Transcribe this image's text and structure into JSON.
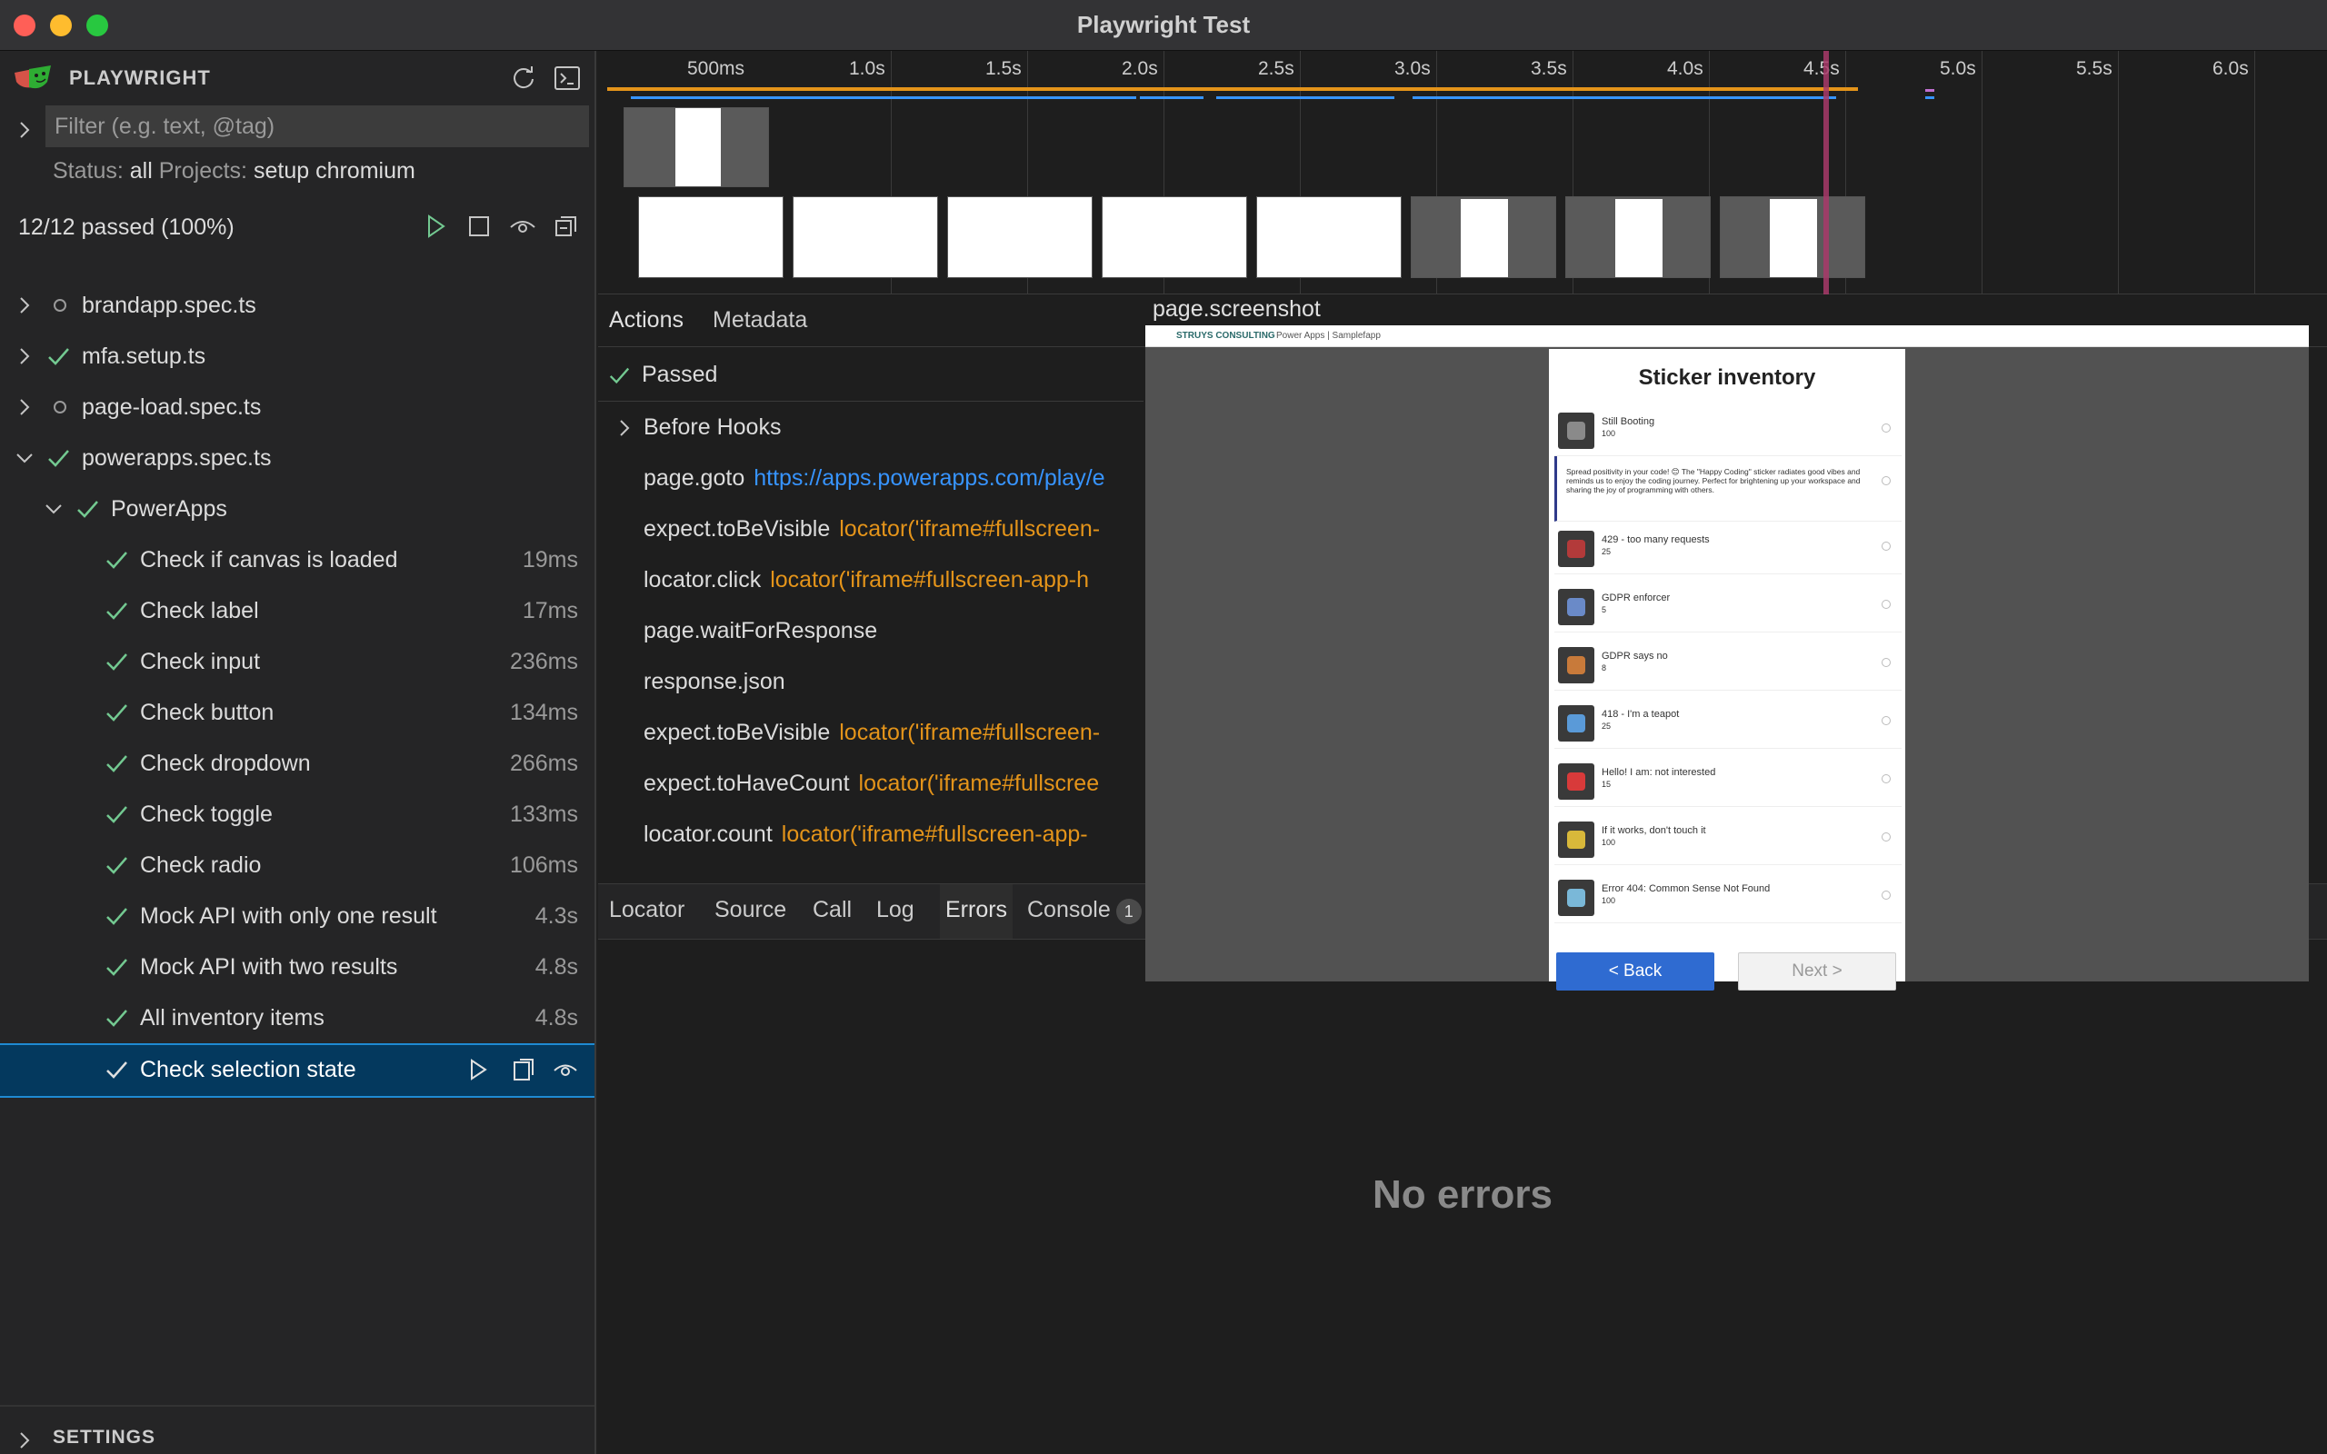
{
  "window": {
    "title": "Playwright Test"
  },
  "sidebar": {
    "brand": "PLAYWRIGHT",
    "filter_placeholder": "Filter (e.g. text, @tag)",
    "status_label": "Status:",
    "status_value": "all",
    "projects_label": "Projects:",
    "projects_value": "setup chromium",
    "summary": "12/12 passed (100%)",
    "files": [
      {
        "label": "brandapp.spec.ts",
        "status": "none"
      },
      {
        "label": "mfa.setup.ts",
        "status": "passed"
      },
      {
        "label": "page-load.spec.ts",
        "status": "none"
      },
      {
        "label": "powerapps.spec.ts",
        "status": "passed"
      }
    ],
    "suite": "PowerApps",
    "tests": [
      {
        "label": "Check if canvas is loaded",
        "duration": "19ms"
      },
      {
        "label": "Check label",
        "duration": "17ms"
      },
      {
        "label": "Check input",
        "duration": "236ms"
      },
      {
        "label": "Check button",
        "duration": "134ms"
      },
      {
        "label": "Check dropdown",
        "duration": "266ms"
      },
      {
        "label": "Check toggle",
        "duration": "133ms"
      },
      {
        "label": "Check radio",
        "duration": "106ms"
      },
      {
        "label": "Mock API with only one result",
        "duration": "4.3s"
      },
      {
        "label": "Mock API with two results",
        "duration": "4.8s"
      },
      {
        "label": "All inventory items",
        "duration": "4.8s"
      },
      {
        "label": "Check selection state",
        "duration": ""
      }
    ],
    "settings": "SETTINGS"
  },
  "timeline": {
    "ticks": [
      "500ms",
      "1.0s",
      "1.5s",
      "2.0s",
      "2.5s",
      "3.0s",
      "3.5s",
      "4.0s",
      "4.5s",
      "5.0s",
      "5.5s",
      "6.0s"
    ]
  },
  "actions": {
    "tabs": [
      "Actions",
      "Metadata"
    ],
    "result": "Passed",
    "hooks": "Before Hooks",
    "rows": [
      {
        "name": "page.goto",
        "arg": "https://apps.powerapps.com/play/e",
        "type": "url"
      },
      {
        "name": "expect.toBeVisible",
        "arg": "locator('iframe#fullscreen-",
        "type": "locator"
      },
      {
        "name": "locator.click",
        "arg": "locator('iframe#fullscreen-app-h",
        "type": "locator"
      },
      {
        "name": "page.waitForResponse",
        "arg": "",
        "type": "plain"
      },
      {
        "name": "response.json",
        "arg": "",
        "type": "plain"
      },
      {
        "name": "expect.toBeVisible",
        "arg": "locator('iframe#fullscreen-",
        "type": "locator"
      },
      {
        "name": "expect.toHaveCount",
        "arg": "locator('iframe#fullscree",
        "type": "locator"
      },
      {
        "name": "locator.count",
        "arg": "locator('iframe#fullscreen-app-",
        "type": "locator"
      }
    ],
    "bottom_tabs": [
      "Locator",
      "Source",
      "Call",
      "Log",
      "Errors",
      "Console"
    ],
    "console_count": "1",
    "no_errors": "No errors"
  },
  "screenshot": {
    "title": "page.screenshot",
    "topbar_brand": "STRUYS CONSULTING",
    "topbar_app": "Power Apps | Samplefapp",
    "app_title": "Sticker inventory",
    "items": [
      {
        "name": "Still Booting",
        "qty": "100",
        "color": "#8a8a8a"
      },
      {
        "name": "",
        "qty": "",
        "desc": "Spread positivity in your code! 😊 The \"Happy Coding\" sticker radiates good vibes and reminds us to enjoy the coding journey. Perfect for brightening up your workspace and sharing the joy of programming with others."
      },
      {
        "name": "429 - too many requests",
        "qty": "25",
        "color": "#b33a3a"
      },
      {
        "name": "GDPR enforcer",
        "qty": "5",
        "color": "#6a8ac8"
      },
      {
        "name": "GDPR says no",
        "qty": "8",
        "color": "#c87a3a"
      },
      {
        "name": "418 - I'm a teapot",
        "qty": "25",
        "color": "#5a9ad8"
      },
      {
        "name": "Hello! I am: not interested",
        "qty": "15",
        "color": "#d83a3a"
      },
      {
        "name": "If it works, don't touch it",
        "qty": "100",
        "color": "#d8b83a"
      },
      {
        "name": "Error 404: Common Sense Not Found",
        "qty": "100",
        "color": "#7ab8d8"
      }
    ],
    "back": "< Back",
    "next": "Next >"
  },
  "colors": {
    "passed": "#73c991",
    "accent": "#1f8ad2",
    "locator": "#e4941a",
    "url": "#3794ff"
  }
}
